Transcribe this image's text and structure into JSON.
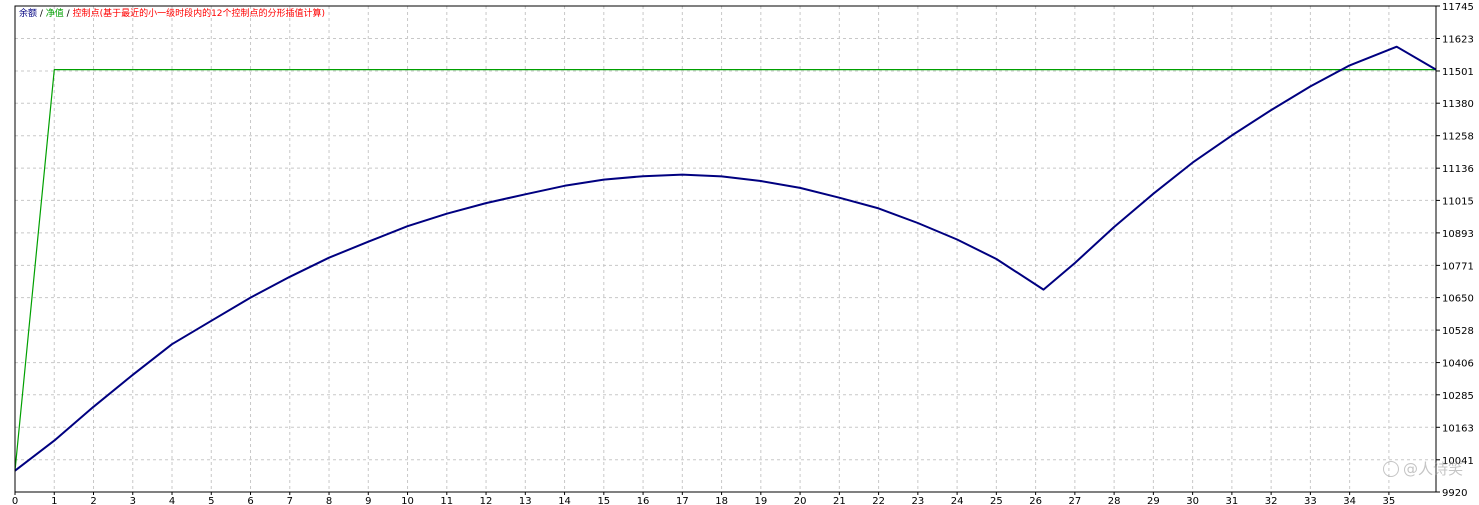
{
  "chart_data": {
    "type": "line",
    "title": "",
    "xlabel": "",
    "ylabel": "",
    "grid": true,
    "legend_position": "top-left",
    "legend": {
      "balance": "余额",
      "equity": "净值",
      "note": "控制点(基于最近的小一级时段内的12个控制点的分形插值计算)",
      "separator": " / "
    },
    "colors": {
      "balance": "#000080",
      "equity": "#00a000",
      "note": "#ff0000",
      "grid": "#c8c8c8",
      "axis": "#000000"
    },
    "x_ticks": [
      "0",
      "1",
      "2",
      "3",
      "4",
      "5",
      "6",
      "7",
      "8",
      "9",
      "10",
      "11",
      "12",
      "13",
      "14",
      "15",
      "16",
      "17",
      "18",
      "19",
      "20",
      "21",
      "22",
      "23",
      "24",
      "25",
      "26",
      "27",
      "28",
      "29",
      "30",
      "31",
      "32",
      "33",
      "34",
      "35"
    ],
    "y_ticks": [
      "11745",
      "11623",
      "11501",
      "11380",
      "11258",
      "11136",
      "11015",
      "10893",
      "10771",
      "10650",
      "10528",
      "10406",
      "10285",
      "10163",
      "10041",
      "9920"
    ],
    "xlim": [
      0,
      36.2
    ],
    "ylim": [
      9920,
      11745
    ],
    "series": [
      {
        "key": "balance",
        "x": [
          0,
          1,
          2,
          3,
          4,
          5,
          6,
          7,
          8,
          9,
          10,
          11,
          12,
          13,
          14,
          15,
          16,
          17,
          18,
          19,
          20,
          21,
          22,
          23,
          24,
          25,
          26.2,
          27,
          28,
          29,
          30,
          31,
          32,
          33,
          34,
          35.2,
          36.2
        ],
        "y": [
          10000,
          10113,
          10240,
          10360,
          10475,
          10563,
          10650,
          10728,
          10800,
          10860,
          10918,
          10965,
          11005,
          11038,
          11070,
          11093,
          11106,
          11112,
          11105,
          11088,
          11062,
          11025,
          10985,
          10930,
          10868,
          10795,
          10680,
          10780,
          10915,
          11040,
          11157,
          11259,
          11354,
          11443,
          11522,
          11592,
          11506
        ]
      },
      {
        "key": "equity",
        "x": [
          0,
          1,
          36.2
        ],
        "y": [
          10000,
          11506,
          11506
        ]
      }
    ],
    "watermark": "@人诗笑"
  }
}
